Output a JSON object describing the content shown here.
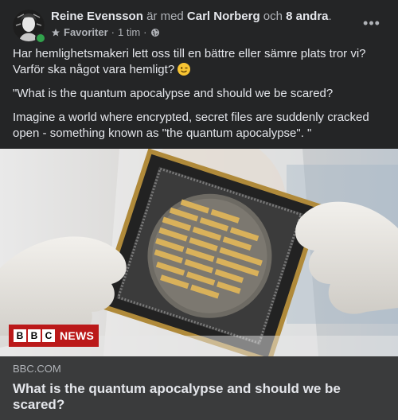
{
  "post": {
    "author": "Reine Evensson",
    "with_text": "är med",
    "tagged_person": "Carl Norberg",
    "and_text": "och",
    "others": "8 andra",
    "dot": ".",
    "audience_label": "Favoriter",
    "separator": "·",
    "time": "1 tim",
    "more_icon": "ellipsis-icon",
    "star_icon": "star-icon",
    "globe_icon": "globe-icon",
    "paragraph1": "Har hemlighetsmakeri lett oss till en bättre eller sämre plats tror vi? Varför ska något vara hemligt?",
    "paragraph2": "\"What is the quantum apocalypse and should we be scared?",
    "paragraph3": "Imagine a world where encrypted, secret files are suddenly cracked open - something known as \"the quantum apocalypse\". \""
  },
  "link": {
    "badge_blocks": [
      "B",
      "B",
      "C"
    ],
    "badge_text": "NEWS",
    "domain": "BBC.COM",
    "title": "What is the quantum apocalypse and should we be scared?"
  },
  "colors": {
    "card_background": "#242526",
    "link_footer": "#3a3b3c",
    "bbc_red": "#bb1919",
    "online_green": "#31a24c"
  }
}
